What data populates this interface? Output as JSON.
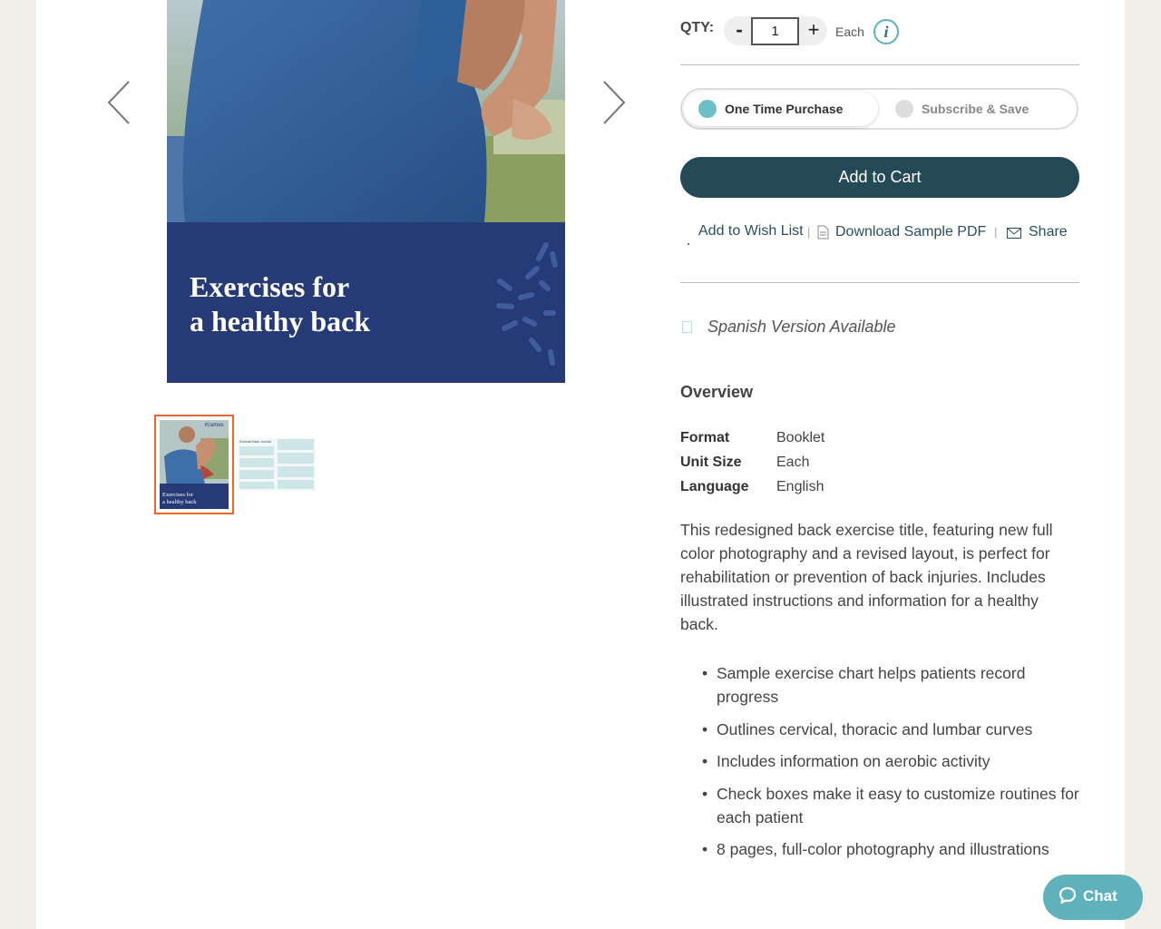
{
  "gallery": {
    "cover_title_line1": "Exercises for",
    "cover_title_line2": "a healthy back",
    "thumb_brand": "Krames",
    "thumb_title_line1": "Exercises for",
    "thumb_title_line2": "a healthy back",
    "thumb2_heading": "Exercise Back Journal"
  },
  "purchase": {
    "qty_label": "QTY:",
    "minus": "-",
    "plus": "+",
    "qty_value": "1",
    "unit": "Each",
    "info_symbol": "i",
    "option_one_time": "One Time Purchase",
    "option_subscribe": "Subscribe & Save",
    "add_to_cart": "Add to Cart"
  },
  "actions": {
    "wish_list": "Add to Wish List",
    "download": "Download Sample PDF",
    "share": "Share",
    "separator": "|"
  },
  "spanish": "Spanish Version Available",
  "overview": {
    "title": "Overview",
    "specs": [
      {
        "key": "Format",
        "value": "Booklet"
      },
      {
        "key": "Unit Size",
        "value": "Each"
      },
      {
        "key": "Language",
        "value": "English"
      }
    ],
    "description": "This redesigned back exercise title, featuring new full color photography and a revised layout, is perfect for rehabilitation or prevention of back injuries. Includes illustrated instructions and information for a healthy back.",
    "bullets": [
      "Sample exercise chart helps patients record progress",
      "Outlines cervical, thoracic and lumbar curves",
      "Includes information on aerobic activity",
      "Check boxes make it easy to customize routines for each patient",
      "8 pages, full-color photography and illustrations"
    ]
  },
  "chat": {
    "label": "Chat"
  },
  "colors": {
    "accent_dark": "#244a58",
    "accent_teal": "#5fb2bb",
    "cover_blue": "#263a78",
    "thumb_active_border": "#e8682c",
    "page_bg": "#f1eee7"
  }
}
